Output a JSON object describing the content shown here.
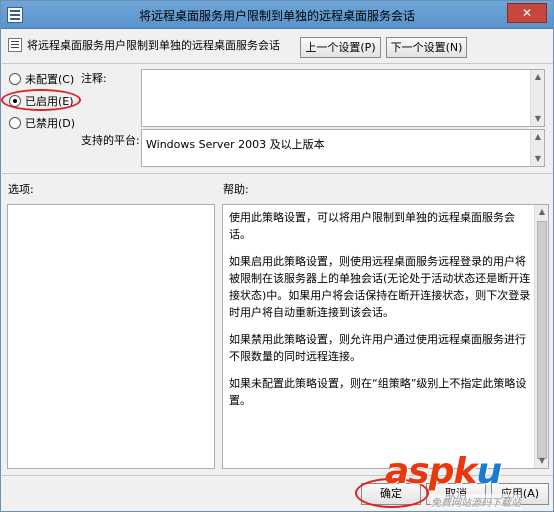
{
  "window": {
    "title": "将远程桌面服务用户限制到单独的远程桌面服务会话",
    "close_label": "✕"
  },
  "header": {
    "policy_name": "将远程桌面服务用户限制到单独的远程桌面服务会话",
    "prev_button": "上一个设置(P)",
    "next_button": "下一个设置(N)"
  },
  "state": {
    "options": [
      {
        "label": "未配置(C)",
        "checked": false
      },
      {
        "label": "已启用(E)",
        "checked": true
      },
      {
        "label": "已禁用(D)",
        "checked": false
      }
    ]
  },
  "comment": {
    "label": "注释:",
    "value": ""
  },
  "platform": {
    "label": "支持的平台:",
    "value": "Windows Server 2003 及以上版本"
  },
  "options_section": {
    "label": "选项:"
  },
  "help_section": {
    "label": "帮助:",
    "paragraphs": [
      "使用此策略设置，可以将用户限制到单独的远程桌面服务会话。",
      "如果启用此策略设置，则使用远程桌面服务远程登录的用户将被限制在该服务器上的单独会话(无论处于活动状态还是断开连接状态)中。如果用户将会话保持在断开连接状态，则下次登录时用户将自动重新连接到该会话。",
      "如果禁用此策略设置，则允许用户通过使用远程桌面服务进行不限数量的同时远程连接。",
      "如果未配置此策略设置，则在“组策略”级别上不指定此策略设置。"
    ]
  },
  "footer": {
    "ok_button": "确定",
    "cancel_button": "取消",
    "apply_button": "应用(A)"
  },
  "watermark": {
    "brand_a": "asp",
    "brand_k": "k",
    "brand_u": "u",
    "sub": "免费网站源码下载站"
  },
  "colors": {
    "annotation": "#dd2222",
    "title_bar": "#6fa6d8"
  }
}
